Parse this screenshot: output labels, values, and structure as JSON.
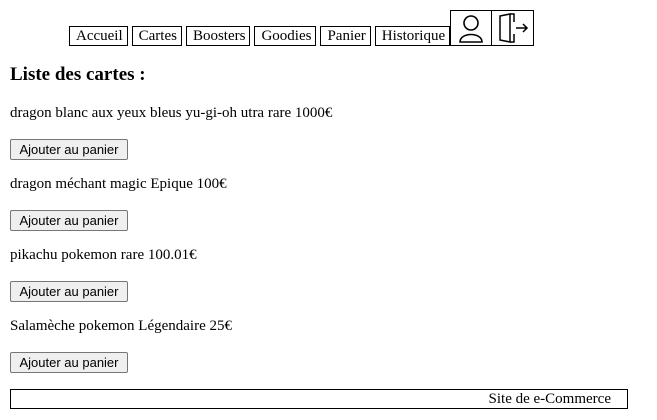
{
  "nav": {
    "items": [
      "Accueil",
      "Cartes",
      "Boosters",
      "Goodies",
      "Panier",
      "Historique"
    ],
    "user_icon": "user-icon",
    "logout_icon": "logout-icon"
  },
  "main": {
    "title": "Liste des cartes :",
    "cards": [
      {
        "text": "dragon blanc aux yeux bleus yu-gi-oh utra rare 1000€",
        "button": "Ajouter au panier"
      },
      {
        "text": "dragon méchant magic Epique 100€",
        "button": "Ajouter au panier"
      },
      {
        "text": "pikachu pokemon rare 100.01€",
        "button": "Ajouter au panier"
      },
      {
        "text": "Salamèche pokemon Légendaire 25€",
        "button": "Ajouter au panier"
      }
    ]
  },
  "footer": {
    "text": "Site de e-Commerce"
  }
}
